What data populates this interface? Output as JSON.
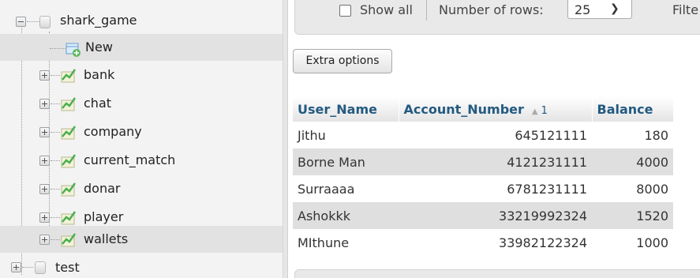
{
  "nav": {
    "database": "shark_game",
    "new_label": "New",
    "tables": [
      "bank",
      "chat",
      "company",
      "current_match",
      "donar",
      "player",
      "wallets"
    ],
    "next_database": "test"
  },
  "topbar": {
    "show_all_label": "Show all",
    "rows_label": "Number of rows:",
    "rows_value": "25",
    "filter_label": "Filte"
  },
  "extra_options_label": "Extra options",
  "table": {
    "columns": [
      "User_Name",
      "Account_Number",
      "Balance"
    ],
    "sort_indicator": "1",
    "rows": [
      [
        "Jithu",
        "645121111",
        "180"
      ],
      [
        "Borne Man",
        "4121231111",
        "4000"
      ],
      [
        "Surraaaa",
        "6781231111",
        "8000"
      ],
      [
        "Ashokkk",
        "33219992324",
        "1520"
      ],
      [
        "MIthune",
        "33982122324",
        "1000"
      ]
    ]
  },
  "colors": {
    "header_text": "#235a81",
    "row_alt": "#dfdfdf",
    "sidebar_bg": "#f3f3f3"
  }
}
